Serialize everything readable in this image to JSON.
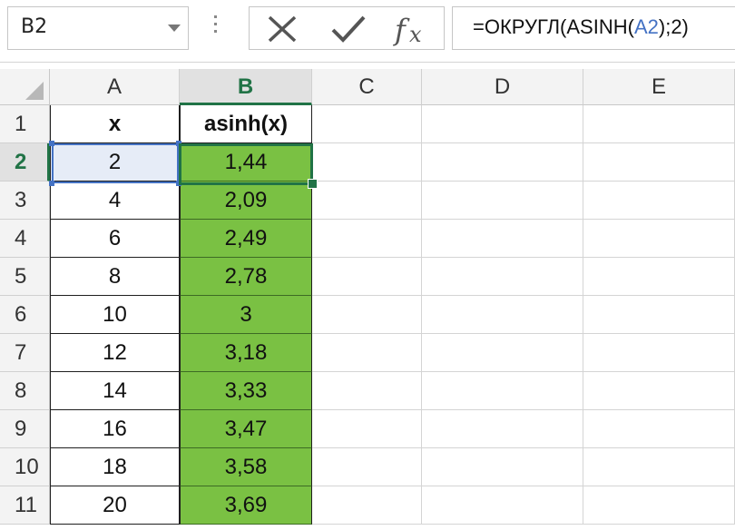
{
  "namebox": {
    "value": "B2"
  },
  "formula_bar": {
    "formula_prefix": "=ОКРУГЛ(ASINH(",
    "formula_ref": "A2",
    "formula_suffix": ");2)",
    "icons": [
      "cancel-icon",
      "enter-icon",
      "insert-function-icon"
    ]
  },
  "columns": [
    "A",
    "B",
    "C",
    "D",
    "E"
  ],
  "selected_column": "B",
  "selected_row": "2",
  "rows": [
    {
      "num": "1",
      "a": "x",
      "b": "asinh(x)"
    },
    {
      "num": "2",
      "a": "2",
      "b": "1,44"
    },
    {
      "num": "3",
      "a": "4",
      "b": "2,09"
    },
    {
      "num": "4",
      "a": "6",
      "b": "2,49"
    },
    {
      "num": "5",
      "a": "8",
      "b": "2,78"
    },
    {
      "num": "6",
      "a": "10",
      "b": "3"
    },
    {
      "num": "7",
      "a": "12",
      "b": "3,18"
    },
    {
      "num": "8",
      "a": "14",
      "b": "3,33"
    },
    {
      "num": "9",
      "a": "16",
      "b": "3,47"
    },
    {
      "num": "10",
      "a": "18",
      "b": "3,58"
    },
    {
      "num": "11",
      "a": "20",
      "b": "3,69"
    }
  ],
  "colors": {
    "accent": "#217346",
    "fill_green": "#7ac143",
    "ref_blue": "#4472c4"
  }
}
